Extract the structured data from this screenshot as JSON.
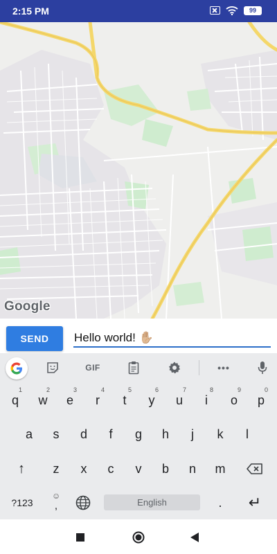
{
  "status_bar": {
    "time": "2:15 PM",
    "icons": [
      "no-sim-icon",
      "wifi-icon",
      "battery-icon"
    ],
    "battery_level": "99",
    "background_color": "#2c3fa0"
  },
  "map": {
    "attribution": "Google",
    "colors": {
      "land": "#efefed",
      "road": "#ffffff",
      "highway": "#f5d96b",
      "park": "#cfeccf",
      "urban": "#e4e2e6"
    }
  },
  "message_bar": {
    "send_label": "SEND",
    "input_value": "Hello world! ✋🏼",
    "accent_color": "#2f7de1"
  },
  "keyboard": {
    "toolbar": {
      "items": [
        "google-g-icon",
        "sticker-icon",
        "gif",
        "clipboard-icon",
        "gear-icon",
        "more-icon",
        "mic-icon"
      ],
      "gif_label": "GIF",
      "more_label": "•••"
    },
    "row1": [
      "q",
      "w",
      "e",
      "r",
      "t",
      "y",
      "u",
      "i",
      "o",
      "p"
    ],
    "row1_hints": [
      "1",
      "2",
      "3",
      "4",
      "5",
      "6",
      "7",
      "8",
      "9",
      "0"
    ],
    "row2": [
      "a",
      "s",
      "d",
      "f",
      "g",
      "h",
      "j",
      "k",
      "l"
    ],
    "row3": [
      "z",
      "x",
      "c",
      "v",
      "b",
      "n",
      "m"
    ],
    "shift_label": "↑",
    "backspace_icon": "backspace-icon",
    "symbols_label": "?123",
    "emoji_label": "☺",
    "comma_label": ",",
    "globe_icon": "globe-icon",
    "space_label": "English",
    "period_label": ".",
    "enter_label": "↵"
  },
  "nav_bar": {
    "items": [
      "recents-square-icon",
      "home-circle-icon",
      "back-triangle-icon"
    ]
  }
}
